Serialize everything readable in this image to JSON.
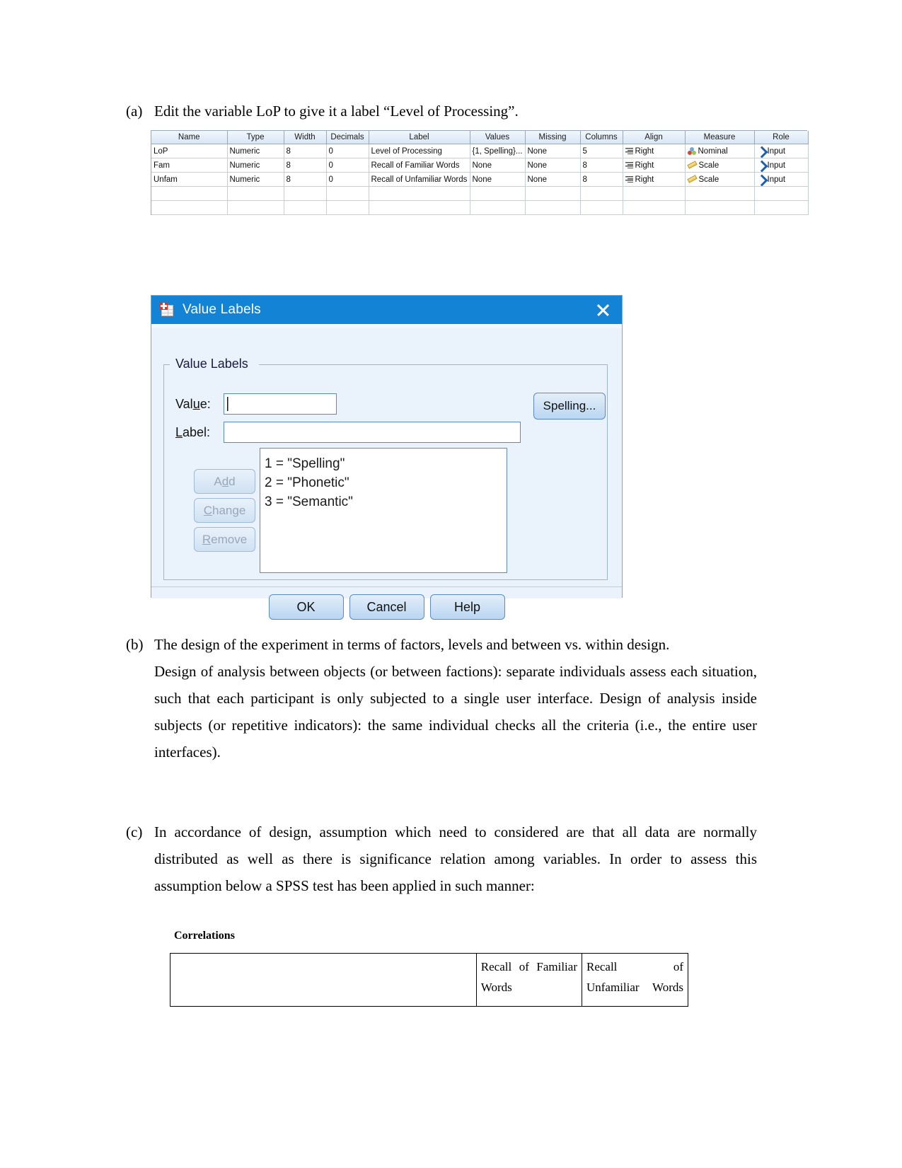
{
  "document": {
    "items": [
      {
        "marker": "(a)",
        "lines": [
          "Edit the variable LoP to give it a label “Level of Processing”."
        ]
      },
      {
        "marker": "(b)",
        "lines": [
          "The design of the experiment in terms of factors, levels and between vs. within design.",
          "Design of analysis between objects (or between factions): separate individuals assess each situation, such that each participant is only subjected to a single user interface. Design of analysis inside subjects (or repetitive indicators): the same individual checks all the criteria (i.e., the entire user interfaces)."
        ]
      },
      {
        "marker": "(c)",
        "lines": [
          "In accordance of design, assumption which need to considered are that all data are normally distributed as well as there is significance relation among variables. In order to assess this assumption below a SPSS test has been applied in such manner:"
        ]
      }
    ]
  },
  "spss_variable_view": {
    "columns": [
      "Name",
      "Type",
      "Width",
      "Decimals",
      "Label",
      "Values",
      "Missing",
      "Columns",
      "Align",
      "Measure",
      "Role"
    ],
    "rows": [
      {
        "name": "LoP",
        "type": "Numeric",
        "width": "8",
        "decimals": "0",
        "label": "Level of Processing",
        "values": "{1, Spelling}...",
        "missing": "None",
        "columns": "5",
        "align": "Right",
        "align_icon": "align-right-icon",
        "measure": "Nominal",
        "measure_icon": "nominal-icon",
        "role": "Input",
        "role_icon": "input-arrow-icon"
      },
      {
        "name": "Fam",
        "type": "Numeric",
        "width": "8",
        "decimals": "0",
        "label": "Recall of Familiar Words",
        "values": "None",
        "missing": "None",
        "columns": "8",
        "align": "Right",
        "align_icon": "align-right-icon",
        "measure": "Scale",
        "measure_icon": "scale-ruler-icon",
        "role": "Input",
        "role_icon": "input-arrow-icon"
      },
      {
        "name": "Unfam",
        "type": "Numeric",
        "width": "8",
        "decimals": "0",
        "label": "Recall of Unfamiliar Words",
        "values": "None",
        "missing": "None",
        "columns": "8",
        "align": "Right",
        "align_icon": "align-right-icon",
        "measure": "Scale",
        "measure_icon": "scale-ruler-icon",
        "role": "Input",
        "role_icon": "input-arrow-icon"
      }
    ]
  },
  "value_labels_dialog": {
    "title": "Value Labels",
    "title_icon": "value-labels-icon",
    "close_icon": "close-icon",
    "group_legend": "Value Labels",
    "value_label": "Val",
    "value_label_underlined": "u",
    "value_label_tail": "e:",
    "value_input": "",
    "label_label_head": "L",
    "label_label_underlined": "a",
    "label_label_tail": "bel:",
    "label_input": "",
    "spelling_button": "Spelling...",
    "side_buttons": [
      {
        "head": "A",
        "underlined": "d",
        "tail": "d",
        "text": "Add"
      },
      {
        "head": "",
        "underlined": "C",
        "tail": "hange",
        "text": "Change"
      },
      {
        "head": "",
        "underlined": "R",
        "tail": "emove",
        "text": "Remove"
      }
    ],
    "list_items": [
      "1 = \"Spelling\"",
      "2 = \"Phonetic\"",
      "3 = \"Semantic\""
    ],
    "footer_buttons": [
      "OK",
      "Cancel",
      "Help"
    ],
    "colors": {
      "titlebar": "#1384d5",
      "dialog_background": "#eaf2fb",
      "button_face": "#b9d6f2"
    }
  },
  "correlations_output": {
    "title": "Correlations",
    "row_label": "",
    "column_headers": [
      "Recall of Familiar Words",
      "Recall of Unfamiliar Words"
    ]
  }
}
